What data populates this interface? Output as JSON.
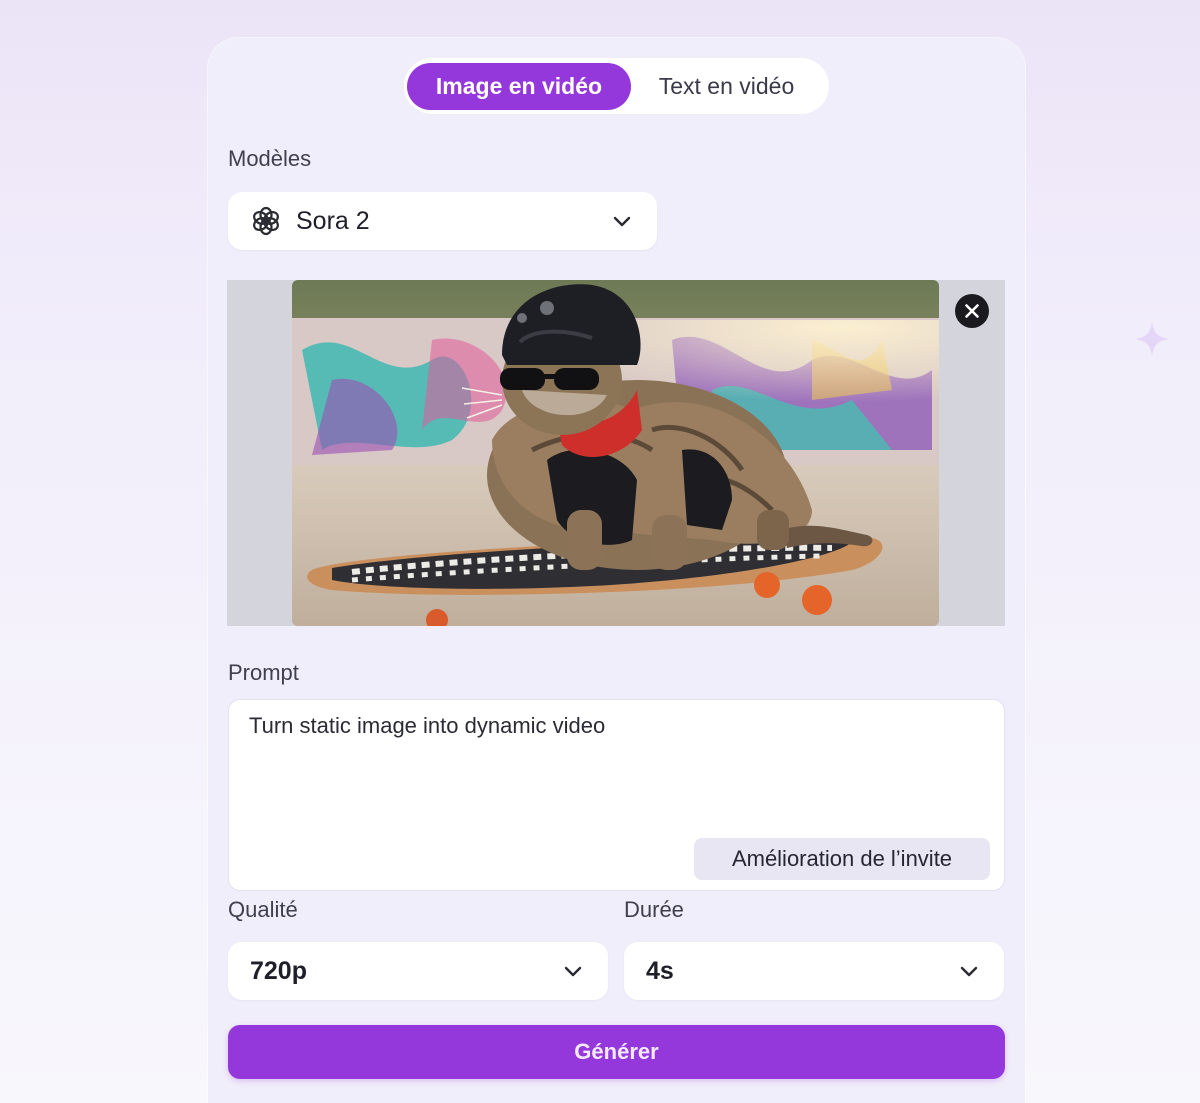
{
  "colors": {
    "accent": "#9438dc",
    "card_bg": "#f1eefb",
    "field_bg": "#ffffff",
    "text": "#1f1f2a"
  },
  "mode_tabs": [
    {
      "label": "Image en vidéo",
      "active": true
    },
    {
      "label": "Text en vidéo",
      "active": false
    }
  ],
  "model": {
    "label": "Modèles",
    "selected": "Sora 2",
    "icon": "openai-logo-icon"
  },
  "image_upload": {
    "preview_alt": "cat-on-skateboard-photo",
    "remove_icon": "close-icon"
  },
  "prompt": {
    "label": "Prompt",
    "value": "Turn static image into dynamic video",
    "enhance_label": "Amélioration de l’invite"
  },
  "quality": {
    "label": "Qualité",
    "selected": "720p"
  },
  "duration": {
    "label": "Durée",
    "selected": "4s"
  },
  "generate_label": "Générer"
}
